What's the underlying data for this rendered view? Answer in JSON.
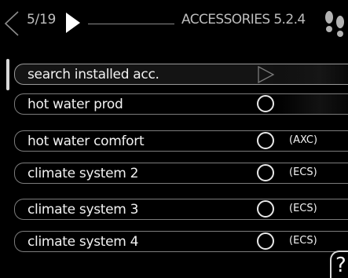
{
  "header": {
    "page_counter": "5/19",
    "title": "ACCESSORIES 5.2.4",
    "back_icon": "chevron-left-icon",
    "next_icon": "play-right-icon",
    "help_icon": "footprints-icon"
  },
  "scrollbar": {
    "position": 0.0
  },
  "menu": {
    "items": [
      {
        "label": "search installed acc.",
        "control": "arrow",
        "tag": ""
      },
      {
        "label": "hot water prod",
        "control": "radio",
        "tag": ""
      },
      {
        "label": "hot water comfort",
        "control": "radio",
        "tag": "(AXC)"
      },
      {
        "label": "climate system 2",
        "control": "radio",
        "tag": "(ECS)"
      },
      {
        "label": "climate system 3",
        "control": "radio",
        "tag": "(ECS)"
      },
      {
        "label": "climate system 4",
        "control": "radio",
        "tag": "(ECS)"
      }
    ]
  },
  "help_button": {
    "label": "?"
  },
  "colors": {
    "background": "#000000",
    "text": "#f2f2f2",
    "header_text": "#bdbdbd",
    "row_border": "#7c7c7c"
  }
}
